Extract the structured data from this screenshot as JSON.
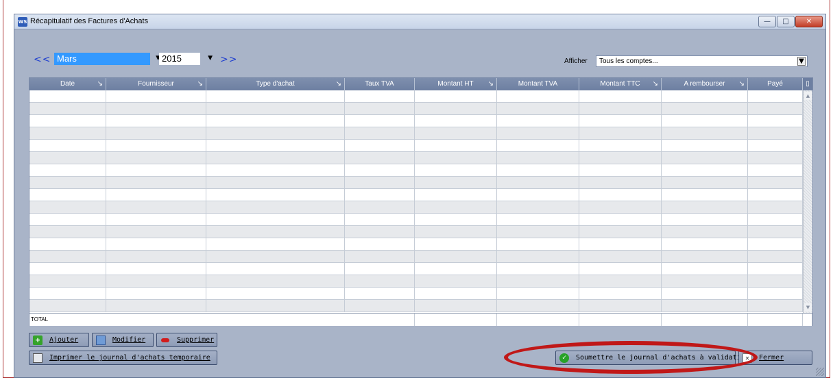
{
  "window": {
    "icon_text": "WS",
    "title": "Récapitulatif des Factures d'Achats",
    "btn_minimize": "—",
    "btn_maximize": "□",
    "btn_close": "✕"
  },
  "nav": {
    "prev_label": "<<",
    "next_label": ">>",
    "month": "Mars",
    "year": "2015",
    "dropdown_arrow": "▼"
  },
  "filter": {
    "label": "Afficher",
    "value": "Tous les comptes..."
  },
  "table": {
    "columns": [
      {
        "label": "Date",
        "sortable": true
      },
      {
        "label": "Fournisseur",
        "sortable": true
      },
      {
        "label": "Type d'achat",
        "sortable": true
      },
      {
        "label": "Taux TVA",
        "sortable": false
      },
      {
        "label": "Montant HT",
        "sortable": true
      },
      {
        "label": "Montant TVA",
        "sortable": false
      },
      {
        "label": "Montant TTC",
        "sortable": true
      },
      {
        "label": "A rembourser",
        "sortable": true
      },
      {
        "label": "Payé",
        "sortable": false
      }
    ],
    "sort_glyph": "↘",
    "corner_glyph": "▯",
    "empty_row_count": 18,
    "total_label": "TOTAL",
    "scroll_up": "▲",
    "scroll_down": "▼"
  },
  "buttons": {
    "ajouter": "Ajouter",
    "modifier": "Modifier",
    "supprimer": "Supprimer",
    "imprimer": "Imprimer le journal d'achats temporaire",
    "soumettre": "Soumettre le journal d'achats à validation",
    "fermer": "Fermer"
  },
  "colors": {
    "window_bg": "#a9b4c8",
    "header_bg": "#7e8fae",
    "selection": "#3399ff",
    "annotation": "#c01818"
  }
}
